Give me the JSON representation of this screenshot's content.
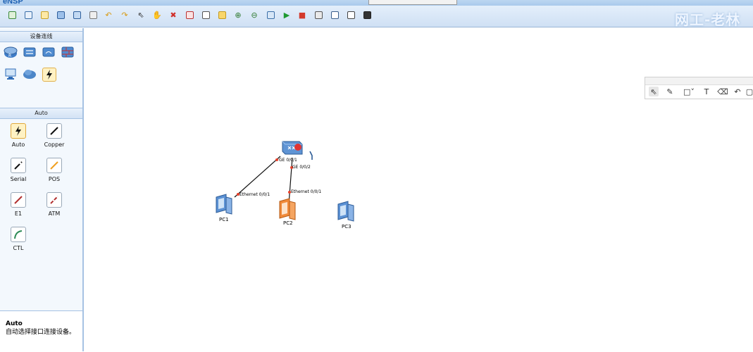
{
  "app": {
    "logo": "eNSP",
    "watermark": "网工-老林"
  },
  "toolbar": {
    "buttons": [
      {
        "name": "new-topology"
      },
      {
        "name": "new-example"
      },
      {
        "name": "open"
      },
      {
        "name": "save"
      },
      {
        "name": "save-as"
      },
      {
        "name": "print"
      },
      {
        "name": "undo"
      },
      {
        "name": "redo"
      },
      {
        "name": "select"
      },
      {
        "name": "move"
      },
      {
        "name": "delete"
      },
      {
        "name": "delete-connection"
      },
      {
        "name": "text"
      },
      {
        "name": "palette"
      },
      {
        "name": "zoom-in"
      },
      {
        "name": "zoom-out"
      },
      {
        "name": "fit"
      },
      {
        "name": "start"
      },
      {
        "name": "stop"
      },
      {
        "name": "capture"
      },
      {
        "name": "show-interface"
      },
      {
        "name": "grid"
      },
      {
        "name": "console"
      }
    ]
  },
  "sidebar": {
    "device_section_title": "设备连线",
    "cable_section_title": "Auto",
    "device_categories": [
      {
        "name": "router",
        "color": "#3e7cc7"
      },
      {
        "name": "switch",
        "color": "#3e7cc7"
      },
      {
        "name": "wlan",
        "color": "#3e7cc7"
      },
      {
        "name": "firewall",
        "color": "#3e7cc7"
      },
      {
        "name": "pc",
        "color": "#2f6db8"
      },
      {
        "name": "cloud",
        "color": "#4c86c8"
      },
      {
        "name": "connection",
        "color": "#222222"
      }
    ],
    "cables": [
      {
        "label": "Auto",
        "color": "#222222",
        "selected": true
      },
      {
        "label": "Copper",
        "color": "#111111",
        "selected": false
      },
      {
        "label": "Serial",
        "color": "#111111",
        "selected": false
      },
      {
        "label": "POS",
        "color": "#f0a020",
        "selected": false
      },
      {
        "label": "E1",
        "color": "#b23030",
        "selected": false
      },
      {
        "label": "ATM",
        "color": "#b23030",
        "selected": false
      },
      {
        "label": "CTL",
        "color": "#2e8b57",
        "selected": false
      }
    ],
    "description": {
      "title": "Auto",
      "text": "自动选择接口连接设备。"
    }
  },
  "canvas": {
    "nodes": [
      {
        "id": "switch",
        "label": ""
      },
      {
        "id": "pc1",
        "label": "PC1"
      },
      {
        "id": "pc2",
        "label": "PC2"
      },
      {
        "id": "pc3",
        "label": "PC3"
      }
    ],
    "port_labels": {
      "sw_to_pc1": "GE 0/0/1",
      "sw_to_pc2": "GE 0/0/2",
      "pc1_port": "Ethernet 0/0/1",
      "pc2_port": "Ethernet 0/0/1"
    }
  },
  "drawbar": {
    "tools": [
      {
        "name": "pointer-tool",
        "glyph": "⇖",
        "active": true
      },
      {
        "name": "pen-tool",
        "glyph": "✎",
        "active": false
      },
      {
        "name": "shape-tool",
        "glyph": "□˅",
        "active": false
      },
      {
        "name": "text-tool",
        "glyph": "T",
        "active": false
      },
      {
        "name": "eraser-tool",
        "glyph": "⌫",
        "active": false
      },
      {
        "name": "undo-tool",
        "glyph": "↶",
        "active": false
      },
      {
        "name": "more-tool",
        "glyph": "▢",
        "active": false
      }
    ]
  }
}
